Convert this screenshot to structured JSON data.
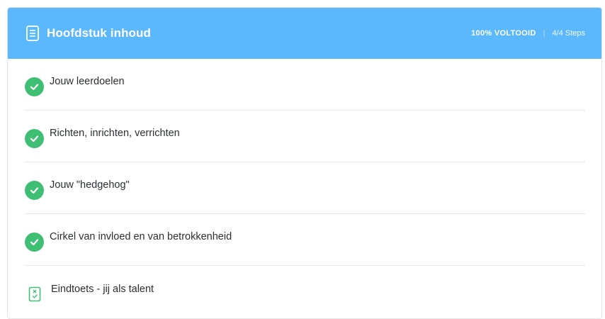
{
  "header": {
    "title": "Hoofdstuk inhoud",
    "icon": "document-icon",
    "progress_percent": 100,
    "progress_label": "100% VOLTOOID",
    "separator": "|",
    "steps_label": "4/4 Steps"
  },
  "colors": {
    "header_bg": "#5cb8fd",
    "complete_green": "#3fbf74",
    "text": "#2b2f33"
  },
  "items": [
    {
      "label": "Jouw leerdoelen",
      "status": "completed",
      "icon": "check-icon"
    },
    {
      "label": "Richten, inrichten, verrichten",
      "status": "completed",
      "icon": "check-icon"
    },
    {
      "label": "Jouw \"hedgehog\"",
      "status": "completed",
      "icon": "check-icon"
    },
    {
      "label": "Cirkel van invloed en van betrokkenheid",
      "status": "completed",
      "icon": "check-icon"
    },
    {
      "label": "Eindtoets - jij als talent",
      "status": "quiz",
      "icon": "quiz-icon"
    }
  ]
}
